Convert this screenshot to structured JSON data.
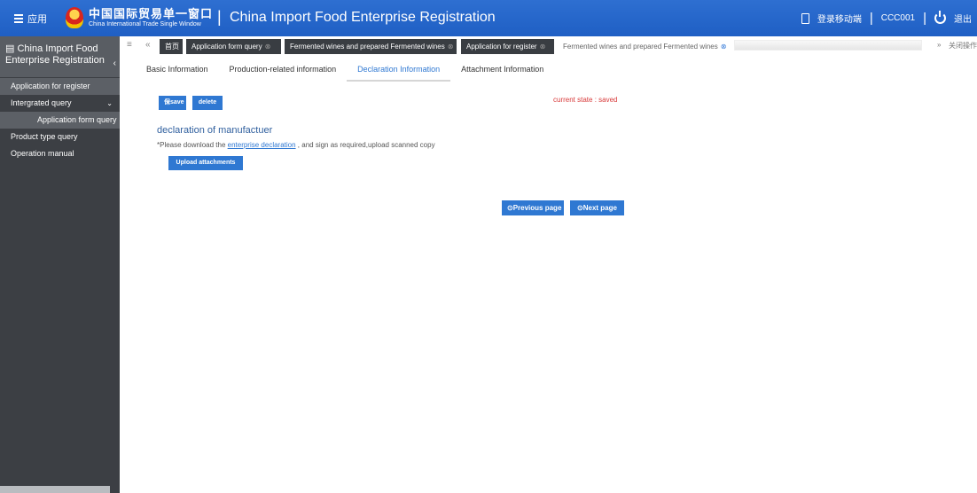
{
  "topbar": {
    "menu_label": "应用",
    "logo_cn": "中国国际贸易单一窗口",
    "logo_en": "China International Trade Single Window",
    "app_separator": "|",
    "app_title": "China Import Food Enterprise Registration",
    "mobile_label": "登录移动端",
    "user_code": "CCC001",
    "logout_label": "退出",
    "separator": "|"
  },
  "sidebar": {
    "title": "China Import Food Enterprise Registration",
    "title_chevron": "‹",
    "items": [
      {
        "label": "Application for register"
      },
      {
        "label": "Intergrated query",
        "arrow": "⌄"
      },
      {
        "label": "Application form query"
      },
      {
        "label": "Product type query"
      },
      {
        "label": "Operation manual"
      }
    ]
  },
  "tabs": {
    "menu_glyph": "≡",
    "back_glyph": "«",
    "forward_glyph": "»",
    "close_glyph": "⊗",
    "items": [
      {
        "label": "首页"
      },
      {
        "label": "Application form query"
      },
      {
        "label": "Fermented wines and prepared Fermented wines"
      },
      {
        "label": "Application for register"
      },
      {
        "label": "Fermented wines and prepared Fermented wines"
      }
    ],
    "close_all_label": "关闭操作"
  },
  "content": {
    "subtabs": [
      {
        "label": "Basic Information"
      },
      {
        "label": "Production-related information"
      },
      {
        "label": "Declaration Information"
      },
      {
        "label": "Attachment Information"
      }
    ],
    "save_label": "保save",
    "delete_label": "delete",
    "state_text": "current state : saved",
    "section_title": "declaration of manufactuer",
    "note_prefix": "*Please download the",
    "note_link": "enterprise declaration",
    "note_suffix": ", and sign as required,upload scanned copy",
    "upload_label": "Upload attachments",
    "prev_label": "⊙Previous page",
    "next_label": "⊙Next page"
  },
  "colors": {
    "topbar": "#2a6bd0",
    "sidebar": "#3c3f44",
    "accent": "#2f78d2",
    "state": "#d83a3a"
  }
}
